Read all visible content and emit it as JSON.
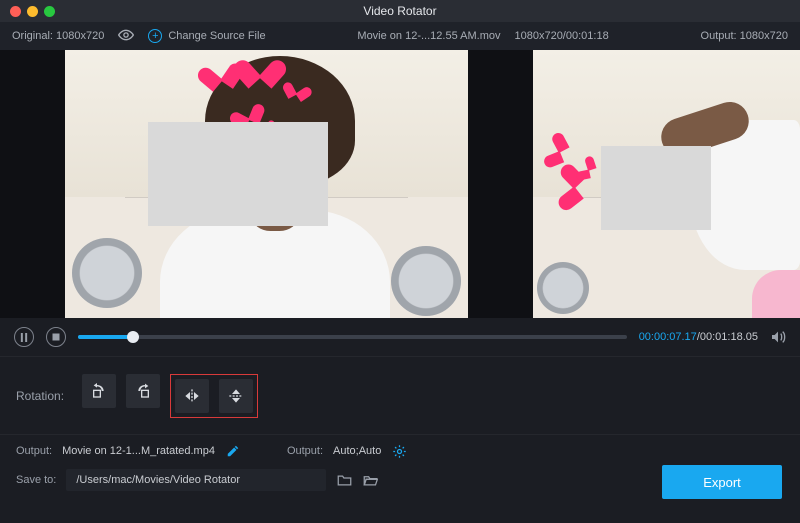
{
  "title": "Video Rotator",
  "infobar": {
    "original_label": "Original: 1080x720",
    "change_source_label": "Change Source File",
    "filename": "Movie on 12-...12.55 AM.mov",
    "src_meta": "1080x720/00:01:18",
    "output_label": "Output: 1080x720"
  },
  "playback": {
    "progress_pct": 10,
    "current_time": "00:00:07.17",
    "total_time": "00:01:18.05"
  },
  "rotation": {
    "label": "Rotation:"
  },
  "output": {
    "label": "Output:",
    "filename": "Movie on 12-1...M_ratated.mp4",
    "size_label": "Output:",
    "size_value": "Auto;Auto"
  },
  "save": {
    "label": "Save to:",
    "path": "/Users/mac/Movies/Video Rotator"
  },
  "export_label": "Export"
}
